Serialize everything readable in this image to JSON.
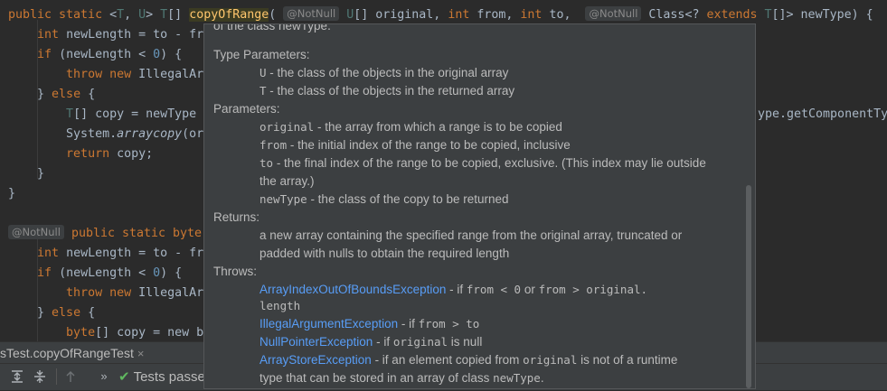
{
  "editor": {
    "lines": [
      {
        "id": "l1",
        "parts": [
          [
            "kw",
            "public static "
          ],
          [
            "ty",
            "<"
          ],
          [
            "gen",
            "T"
          ],
          [
            "ty",
            ", "
          ],
          [
            "gen",
            "U"
          ],
          [
            "ty",
            "> "
          ],
          [
            "gen",
            "T"
          ],
          [
            "ty",
            "[] "
          ],
          [
            "fn hl",
            "copyOfRange"
          ],
          [
            "ty",
            "( "
          ],
          [
            "ann",
            "@NotNull"
          ],
          [
            "ty",
            " "
          ],
          [
            "gen",
            "U"
          ],
          [
            "ty",
            "[] original, "
          ],
          [
            "kw",
            "int "
          ],
          [
            "ty",
            "from, "
          ],
          [
            "kw",
            "int "
          ],
          [
            "ty",
            "to,  "
          ],
          [
            "ann",
            "@NotNull"
          ],
          [
            "ty",
            " Class<? "
          ],
          [
            "kw",
            "extends "
          ],
          [
            "gen",
            "T"
          ],
          [
            "ty",
            "[]> newType) {"
          ]
        ]
      },
      {
        "id": "l2",
        "parts": [
          [
            "ty",
            "    "
          ],
          [
            "kw",
            "int "
          ],
          [
            "ty",
            "newLength = to - fr"
          ]
        ]
      },
      {
        "id": "l3",
        "parts": [
          [
            "ty",
            "    "
          ],
          [
            "kw",
            "if "
          ],
          [
            "ty",
            "(newLength < "
          ],
          [
            "num",
            "0"
          ],
          [
            "ty",
            ") {"
          ]
        ]
      },
      {
        "id": "l4",
        "parts": [
          [
            "ty",
            "        "
          ],
          [
            "kw",
            "throw new "
          ],
          [
            "ty",
            "IllegalAr"
          ]
        ]
      },
      {
        "id": "l5",
        "parts": [
          [
            "ty",
            "    } "
          ],
          [
            "kw",
            "else "
          ],
          [
            "ty",
            "{"
          ]
        ]
      },
      {
        "id": "l6",
        "parts": [
          [
            "ty",
            "        "
          ],
          [
            "gen",
            "T"
          ],
          [
            "ty",
            "[] copy = newType"
          ]
        ],
        "tail": "ype.getComponentTyp"
      },
      {
        "id": "l7",
        "parts": [
          [
            "ty",
            "        System."
          ],
          [
            "it",
            "arraycopy"
          ],
          [
            "ty",
            "(or"
          ]
        ]
      },
      {
        "id": "l8",
        "parts": [
          [
            "ty",
            "        "
          ],
          [
            "kw",
            "return "
          ],
          [
            "ty",
            "copy;"
          ]
        ]
      },
      {
        "id": "l9",
        "parts": [
          [
            "ty",
            "    }"
          ]
        ]
      },
      {
        "id": "l10",
        "parts": [
          [
            "ty",
            "}"
          ]
        ]
      },
      {
        "id": "l11",
        "parts": []
      },
      {
        "id": "l12",
        "parts": [
          [
            "ann",
            "@NotNull"
          ],
          [
            "ty",
            " "
          ],
          [
            "kw",
            "public static byte"
          ]
        ]
      },
      {
        "id": "l13",
        "parts": [
          [
            "ty",
            "    "
          ],
          [
            "kw",
            "int "
          ],
          [
            "ty",
            "newLength = to - fr"
          ]
        ]
      },
      {
        "id": "l14",
        "parts": [
          [
            "ty",
            "    "
          ],
          [
            "kw",
            "if "
          ],
          [
            "ty",
            "(newLength < "
          ],
          [
            "num",
            "0"
          ],
          [
            "ty",
            ") {"
          ]
        ]
      },
      {
        "id": "l15",
        "parts": [
          [
            "ty",
            "        "
          ],
          [
            "kw",
            "throw new "
          ],
          [
            "ty",
            "IllegalAr"
          ]
        ]
      },
      {
        "id": "l16",
        "parts": [
          [
            "ty",
            "    } "
          ],
          [
            "kw",
            "else "
          ],
          [
            "ty",
            "{"
          ]
        ]
      },
      {
        "id": "l17",
        "parts": [
          [
            "ty",
            "        "
          ],
          [
            "kw",
            "byte"
          ],
          [
            "ty",
            "[] copy = new b"
          ]
        ]
      }
    ]
  },
  "doc": {
    "cut_line": "of the class newType.",
    "type_params_heading": "Type Parameters:",
    "type_params": [
      {
        "name": "U",
        "desc": " - the class of the objects in the original array"
      },
      {
        "name": "T",
        "desc": " - the class of the objects in the returned array"
      }
    ],
    "params_heading": "Parameters:",
    "params": [
      {
        "name": "original",
        "desc": " - the array from which a range is to be copied"
      },
      {
        "name": "from",
        "desc": " - the initial index of the range to be copied, inclusive"
      },
      {
        "name": "to",
        "desc": " - the final index of the range to be copied, exclusive. (This index may lie outside"
      },
      {
        "name": "",
        "desc": "the array.)"
      },
      {
        "name": "newType",
        "desc": " - the class of the copy to be returned"
      }
    ],
    "returns_heading": "Returns:",
    "returns": [
      "a new array containing the specified range from the original array, truncated or",
      "padded with nulls to obtain the required length"
    ],
    "throws_heading": "Throws:",
    "throws": [
      {
        "link": "ArrayIndexOutOfBoundsException",
        "rest": [
          [
            "t",
            " - if "
          ],
          [
            "m",
            "from < 0"
          ],
          [
            "t",
            " or "
          ],
          [
            "m",
            "from > original."
          ]
        ]
      },
      {
        "link": "",
        "rest": [
          [
            "m",
            "length"
          ]
        ]
      },
      {
        "link": "IllegalArgumentException",
        "rest": [
          [
            "t",
            " - if "
          ],
          [
            "m",
            "from > to"
          ]
        ]
      },
      {
        "link": "NullPointerException",
        "rest": [
          [
            "t",
            " - if "
          ],
          [
            "m",
            "original"
          ],
          [
            "t",
            " is null"
          ]
        ]
      },
      {
        "link": "ArrayStoreException",
        "rest": [
          [
            "t",
            " - if an element copied from "
          ],
          [
            "m",
            "original"
          ],
          [
            "t",
            " is not of a runtime"
          ]
        ]
      },
      {
        "link": "",
        "rest": [
          [
            "t",
            "type that can be stored in an array of class "
          ],
          [
            "m",
            "newType"
          ],
          [
            "t",
            "."
          ]
        ]
      }
    ]
  },
  "run_panel": {
    "tab_label": "sTest.copyOfRangeTest",
    "close_glyph": "×",
    "status_text": "Tests passe",
    "check_glyph": "✔",
    "more_glyph": "»",
    "icons": [
      "expand-all-icon",
      "collapse-all-icon",
      "up-arrow-icon"
    ]
  }
}
